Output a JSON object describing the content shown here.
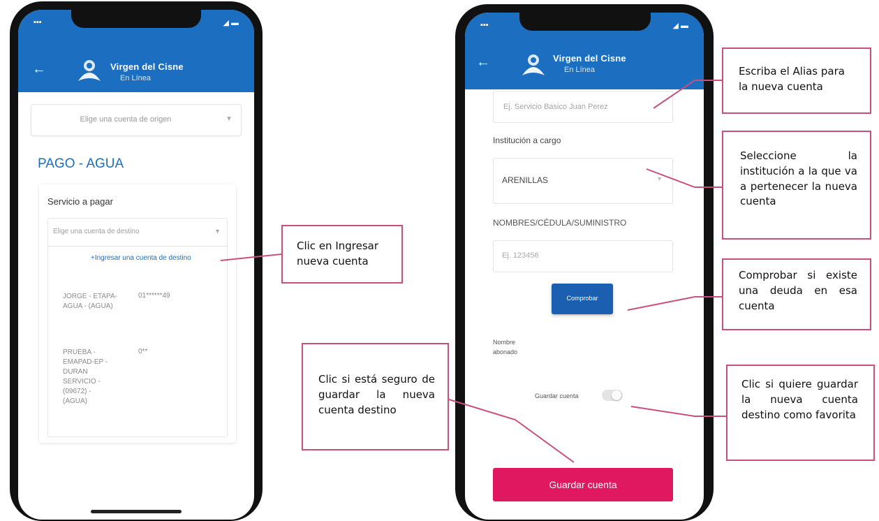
{
  "left_phone": {
    "brand_title": "Virgen del Cisne",
    "brand_sub": "En Línea",
    "origin_select": "Elige una cuenta de origen",
    "section_title": "PAGO - AGUA",
    "service_label": "Servicio a pagar",
    "dest_select": "Elige una cuenta de destino",
    "add_link": "+Ingresar una cuenta de destino",
    "accounts": [
      {
        "name": "JORGE - ETAPA-AGUA - (AGUA)",
        "number": "01******49"
      },
      {
        "name": "PRUEBA - EMAPAD-EP - DURAN SERVICIO - (09672) - (AGUA)",
        "number": "0**"
      }
    ]
  },
  "right_phone": {
    "brand_title": "Virgen del Cisne",
    "brand_sub": "En Línea",
    "alias_placeholder": "Ej. Servicio Basico Juan Perez",
    "institution_label": "Institución a cargo",
    "institution_value": "ARENILLAS",
    "id_label": "NOMBRES/CÉDULA/SUMINISTRO",
    "id_placeholder": "Ej. 123456",
    "check_button": "Comprobar",
    "holder_label": "Nombre abonado",
    "save_toggle_label": "Guardar cuenta",
    "save_button": "Guardar cuenta"
  },
  "callouts": {
    "click_new_account": "Clic en Ingresar nueva cuenta",
    "alias": "Escriba el Alias para la nueva cuenta",
    "institution": "Seleccione la institución a la que va a pertenecer la nueva cuenta",
    "check_debt": "Comprobar si existe una deuda en esa cuenta",
    "save_sure": "Clic si está seguro de guardar la nueva cuenta destino",
    "favorite": "Clic si quiere guardar la nueva cuenta destino como favorita"
  },
  "colors": {
    "brand_blue": "#1b6ec0",
    "accent_pink": "#e0185f",
    "callout_border": "#c8507f"
  }
}
